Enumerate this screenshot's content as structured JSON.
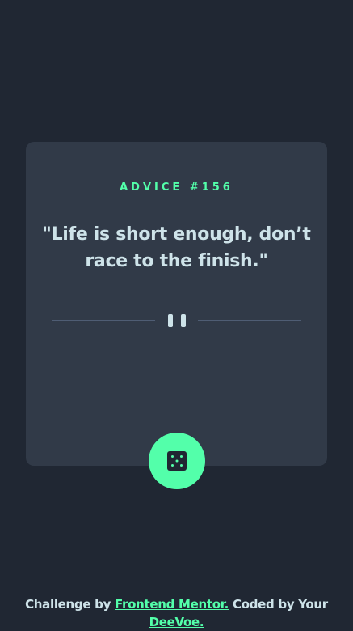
{
  "card": {
    "advice_label": "ADVICE #156",
    "quote": "\"Life is short enough, don’t race to the finish.\""
  },
  "dice_button": {
    "icon": "dice-icon",
    "accent_color": "#53ffaa"
  },
  "footer": {
    "prefix": "Challenge by ",
    "frontend_mentor_link": "Frontend Mentor.",
    "middle": " Coded by Your ",
    "author_link": "DeeVoe."
  },
  "colors": {
    "background": "#202733",
    "card": "#313a48",
    "text": "#cee3e9",
    "accent": "#53ffaa",
    "divider": "#4f5d74"
  }
}
